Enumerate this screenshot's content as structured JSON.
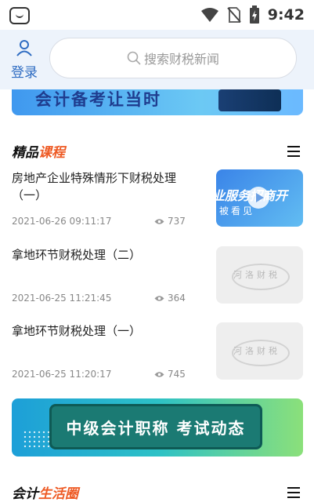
{
  "status_bar": {
    "time": "9:42",
    "icons": [
      "app-icon",
      "wifi-icon",
      "no-sim-icon",
      "battery-icon"
    ]
  },
  "header": {
    "login_label": "登录",
    "search_placeholder": "搜索财税新闻"
  },
  "top_banner": {
    "text": "会计备考让当时"
  },
  "courses_section": {
    "title_part1": "精品",
    "title_part2": "课程",
    "items": [
      {
        "title": "房地产企业特殊情形下财税处理（一）",
        "date": "2021-06-26 09:11:17",
        "views": "737",
        "thumb_text": "业服务招商开",
        "thumb_subtext": "被看见"
      },
      {
        "title": "拿地环节财税处理（二）",
        "date": "2021-06-25 11:21:45",
        "views": "364",
        "thumb_watermark": "河洛财税"
      },
      {
        "title": "拿地环节财税处理（一）",
        "date": "2021-06-25 11:20:17",
        "views": "745",
        "thumb_watermark": "河洛财税"
      }
    ]
  },
  "mid_banner": {
    "text": "中级会计职称 考试动态"
  },
  "bottom_section": {
    "title_part1": "会计",
    "title_part2": "生活圈"
  },
  "colors": {
    "accent": "#ee5a24",
    "link_blue": "#2f6cc2",
    "header_bg": "#edf3fb"
  }
}
